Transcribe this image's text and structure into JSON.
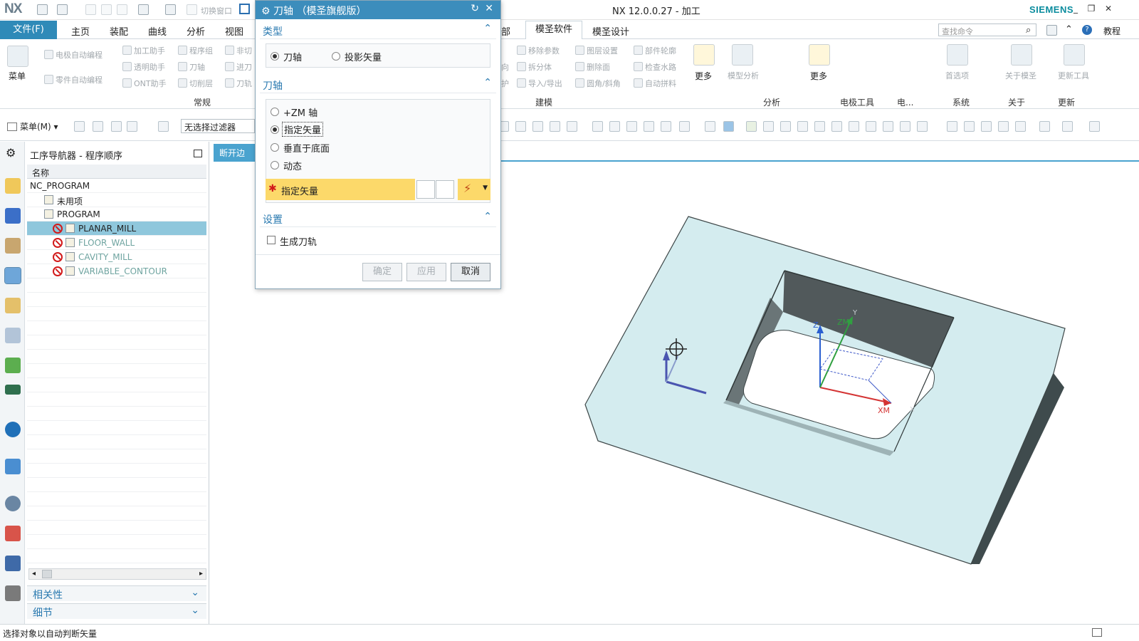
{
  "app": {
    "logo": "NX",
    "title": "NX 12.0.0.27 - 加工",
    "brand": "SIEMENS"
  },
  "ribbon": {
    "file_tab": "文件(F)",
    "tabs": [
      "主页",
      "装配",
      "曲线",
      "分析",
      "视图",
      "部",
      "模圣软件",
      "模圣设计"
    ],
    "search_placeholder": "查找命令",
    "help_label": "教程",
    "menu_label": "菜单",
    "groups": {
      "general": {
        "label": "常规",
        "items": [
          "电极自动编程",
          "加工助手",
          "程序组",
          "非切",
          "零件自动编程",
          "透明助手",
          "刀轴",
          "进刀",
          "ONT助手",
          "切削层",
          "刀轨"
        ],
        "partial": "切换窗口"
      },
      "modeling": {
        "label": "建模",
        "items": [
          "移除参数",
          "图层设置",
          "部件轮廓",
          "拆分体",
          "删除面",
          "检查水路",
          "导入/导出",
          "圆角/斜角",
          "自动拼料"
        ],
        "partial_left": [
          "向",
          "护"
        ]
      },
      "analysis": {
        "label": "分析",
        "items": [
          "模型分析"
        ]
      },
      "electrode": {
        "label": "电极工具"
      },
      "electrode2": {
        "label": "电..."
      },
      "system": {
        "label": "系统",
        "items": [
          "首选项"
        ]
      },
      "about": {
        "label": "关于",
        "items": [
          "关于模圣"
        ]
      },
      "update": {
        "label": "更新",
        "items": [
          "更新工具"
        ]
      },
      "more_label": "更多"
    }
  },
  "toolbar2": {
    "menu_label": "菜单(M)",
    "filter_value": "无选择过滤器"
  },
  "navigator": {
    "title": "工序导航器 - 程序顺序",
    "column_header": "名称",
    "rows": [
      {
        "label": "NC_PROGRAM",
        "indent": 0,
        "state": "root"
      },
      {
        "label": "未用项",
        "indent": 1,
        "state": "folder"
      },
      {
        "label": "PROGRAM",
        "indent": 1,
        "state": "program"
      },
      {
        "label": "PLANAR_MILL",
        "indent": 2,
        "state": "selected"
      },
      {
        "label": "FLOOR_WALL",
        "indent": 2,
        "state": "dim"
      },
      {
        "label": "CAVITY_MILL",
        "indent": 2,
        "state": "dim"
      },
      {
        "label": "VARIABLE_CONTOUR",
        "indent": 2,
        "state": "dim"
      }
    ],
    "panels": [
      "相关性",
      "细节"
    ]
  },
  "view_tab": "断开边",
  "dialog": {
    "title": "刀轴 （模圣旗舰版）",
    "sections": {
      "type": {
        "label": "类型",
        "options": [
          "刀轴",
          "投影矢量"
        ],
        "selected": "刀轴"
      },
      "axis": {
        "label": "刀轴",
        "options": [
          "+ZM 轴",
          "指定矢量",
          "垂直于底面",
          "动态"
        ],
        "selected": "指定矢量",
        "vector_label": "指定矢量"
      },
      "settings": {
        "label": "设置",
        "checkbox_label": "生成刀轨",
        "checked": false
      }
    },
    "buttons": {
      "ok": "确定",
      "apply": "应用",
      "cancel": "取消"
    }
  },
  "viewport": {
    "axis_labels": {
      "z": "Z",
      "zm": "ZM",
      "xm": "XM",
      "y": "Y",
      "x": "X"
    }
  },
  "status": {
    "text": "选择对象以自动判断矢量"
  },
  "colors": {
    "accent": "#3c8dbc",
    "selected_row": "#8fc7dc",
    "highlight_row": "#fcd96a",
    "part_top": "#d4ecef",
    "part_side": "#4a5658",
    "error": "#d21a1a"
  }
}
